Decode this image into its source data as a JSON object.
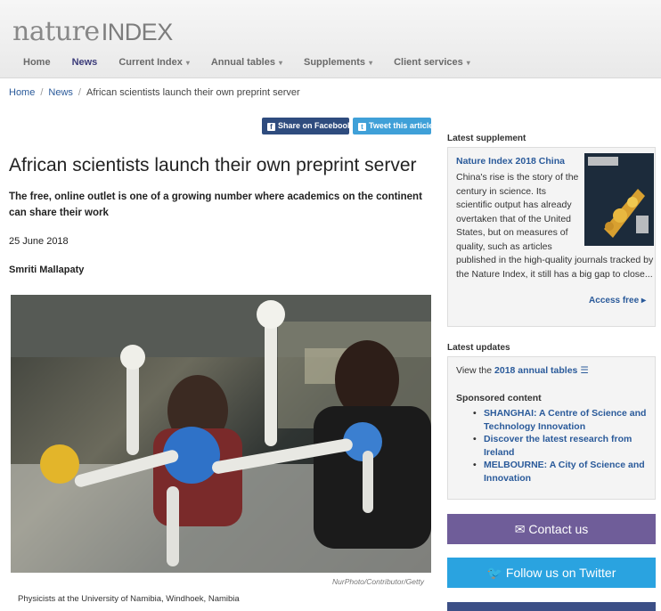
{
  "site": {
    "logo_main": "nature",
    "logo_index": "INDEX"
  },
  "nav": {
    "items": [
      {
        "label": "Home",
        "caret": false
      },
      {
        "label": "News",
        "caret": false
      },
      {
        "label": "Current Index",
        "caret": true
      },
      {
        "label": "Annual tables",
        "caret": true
      },
      {
        "label": "Supplements",
        "caret": true
      },
      {
        "label": "Client services",
        "caret": true
      }
    ],
    "active": "News"
  },
  "breadcrumb": {
    "home": "Home",
    "news": "News",
    "current": "African scientists launch their own preprint server"
  },
  "share": {
    "facebook": "Share on Facebook",
    "twitter": "Tweet this article"
  },
  "article": {
    "title": "African scientists launch their own preprint server",
    "standfirst": "The free, online outlet is one of a growing number where academics on the continent can share their work",
    "date": "25 June 2018",
    "author": "Smriti Mallapaty",
    "image_credit": "NurPhoto/Contributor/Getty",
    "caption": "Physicists at the University of Namibia, Windhoek, Namibia"
  },
  "sidebar": {
    "supplement_label": "Latest supplement",
    "supplement_title": "Nature Index 2018 China",
    "supplement_text": "China's rise is the story of the century in science. Its scientific output has already overtaken that of the United States, but on measures of quality, such as articles published in the high-quality journals tracked by the Nature Index, it still has a big gap to close...",
    "access": "Access free",
    "updates_label": "Latest updates",
    "view_prefix": "View the",
    "view_link": "2018 annual tables",
    "sponsored_label": "Sponsored content",
    "sponsored": [
      "SHANGHAI: A Centre of Science and Technology Innovation",
      "Discover the latest research from Ireland",
      "MELBOURNE: A City of Science and Innovation"
    ],
    "contact": "Contact us",
    "follow": "Follow us on Twitter"
  },
  "icons": {
    "facebook": "facebook-icon",
    "twitter": "twitter-icon",
    "envelope": "envelope-icon",
    "list": "list-icon",
    "arrow": "arrow-right-icon"
  },
  "colors": {
    "accent": "#2a5a9a",
    "contact": "#6f5d99",
    "twitter": "#2aa3e0",
    "facebook": "#2f4c7e"
  }
}
